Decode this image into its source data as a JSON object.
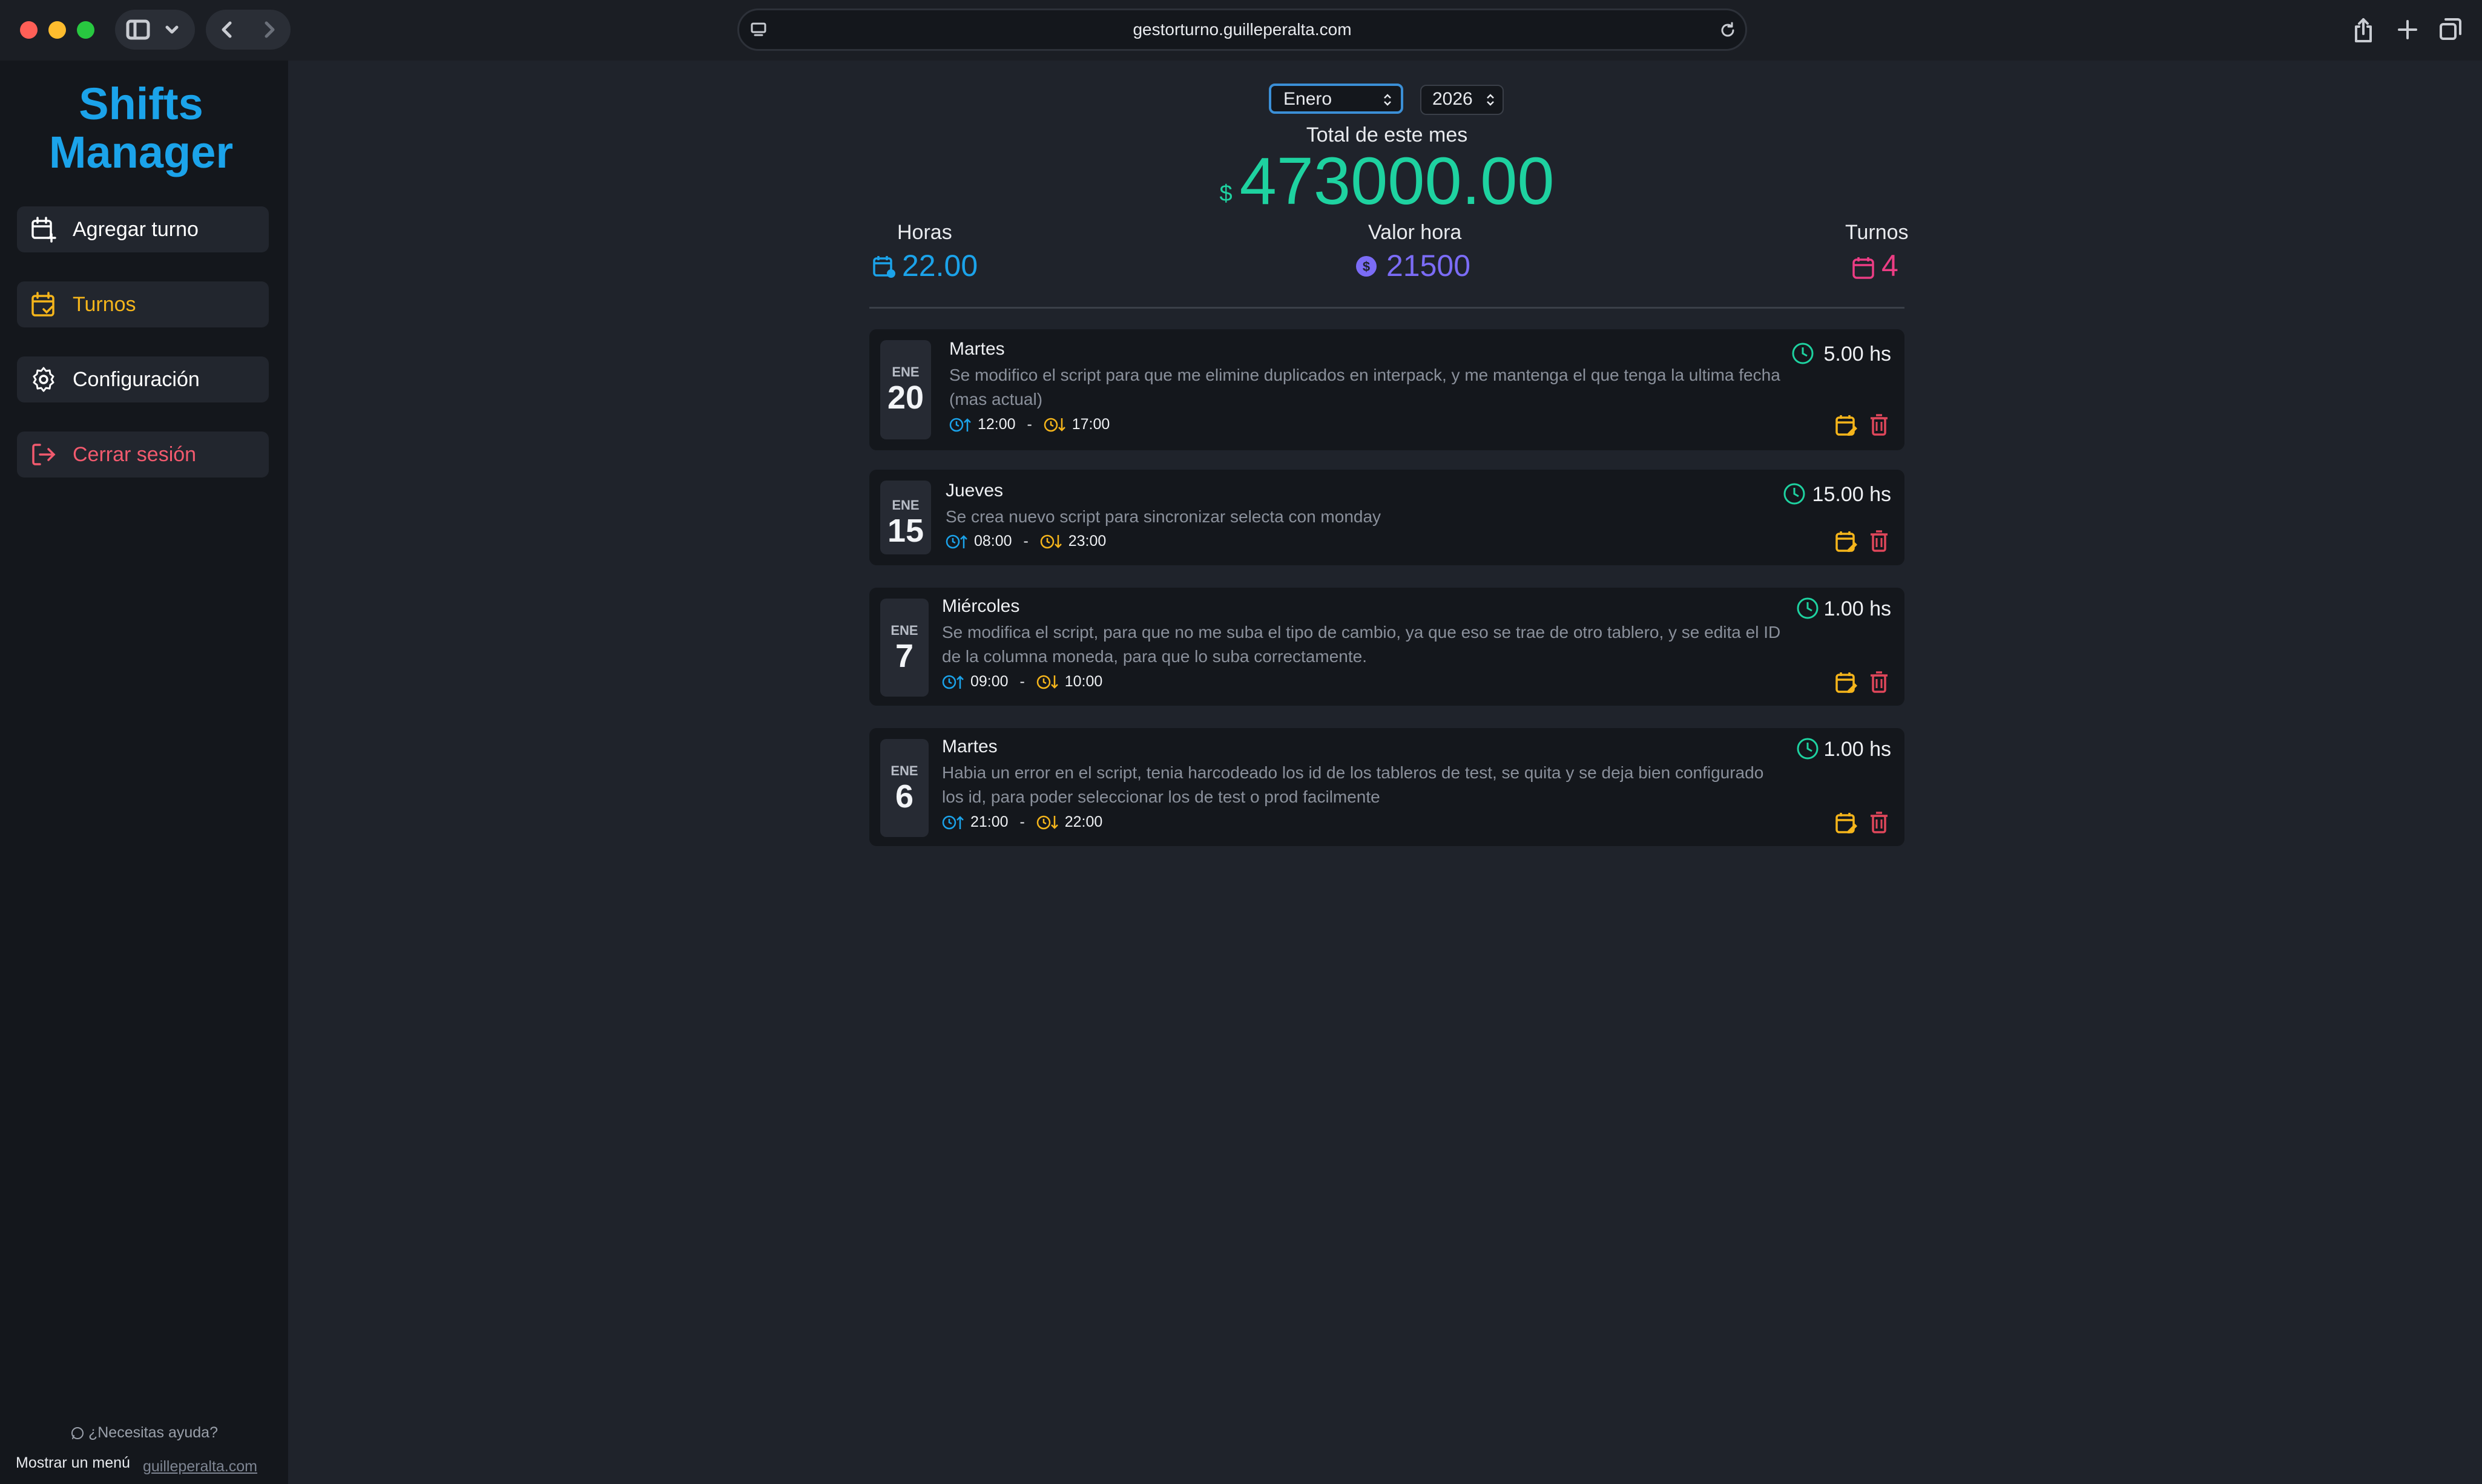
{
  "browser": {
    "url": "gestorturno.guilleperalta.com"
  },
  "sidebar": {
    "brand_line1": "Shifts",
    "brand_line2": "Manager",
    "items": [
      {
        "label": "Agregar turno",
        "color": "#ffffff"
      },
      {
        "label": "Turnos",
        "color": "#f5b51b"
      },
      {
        "label": "Configuración",
        "color": "#ffffff"
      },
      {
        "label": "Cerrar sesión",
        "color": "#f25a6e"
      }
    ],
    "help_text": "¿Necesitas ayuda?",
    "show_menu": "Mostrar un menú",
    "site_link": "guilleperalta.com"
  },
  "header": {
    "month": "Enero",
    "year": "2026",
    "total_label": "Total de este mes",
    "currency_symbol": "$",
    "total_amount": "473000.00"
  },
  "stats": {
    "hours_label": "Horas",
    "hours_value": "22.00",
    "rate_label": "Valor hora",
    "rate_value": "21500",
    "shifts_label": "Turnos",
    "shifts_value": "4"
  },
  "colors": {
    "accent_blue": "#1ba3ea",
    "accent_green": "#1ed2a0",
    "accent_purple": "#7b6cf6",
    "accent_pink": "#ec3d84",
    "accent_orange": "#f5b51b",
    "accent_red": "#e0475b"
  },
  "shifts": [
    {
      "month": "ENE",
      "day": "20",
      "weekday": "Martes",
      "description": "Se modifico el script para que me elimine duplicados en interpack, y me mantenga el que tenga la ultima fecha (mas actual)",
      "start": "12:00",
      "separator": "-",
      "end": "17:00",
      "hours": "5.00 hs"
    },
    {
      "month": "ENE",
      "day": "15",
      "weekday": "Jueves",
      "description": "Se crea nuevo script para sincronizar selecta con monday",
      "start": "08:00",
      "separator": "-",
      "end": "23:00",
      "hours": "15.00 hs"
    },
    {
      "month": "ENE",
      "day": "7",
      "weekday": "Miércoles",
      "description": "Se modifica el script, para que no me suba el tipo de cambio, ya que eso se trae de otro tablero, y se edita el ID de la columna moneda, para que lo suba correctamente.",
      "start": "09:00",
      "separator": "-",
      "end": "10:00",
      "hours": "1.00 hs"
    },
    {
      "month": "ENE",
      "day": "6",
      "weekday": "Martes",
      "description": "Habia un error en el script, tenia harcodeado los id de los tableros de test, se quita y se deja bien configurado los id, para poder seleccionar los de test o prod facilmente",
      "start": "21:00",
      "separator": "-",
      "end": "22:00",
      "hours": "1.00 hs"
    }
  ]
}
